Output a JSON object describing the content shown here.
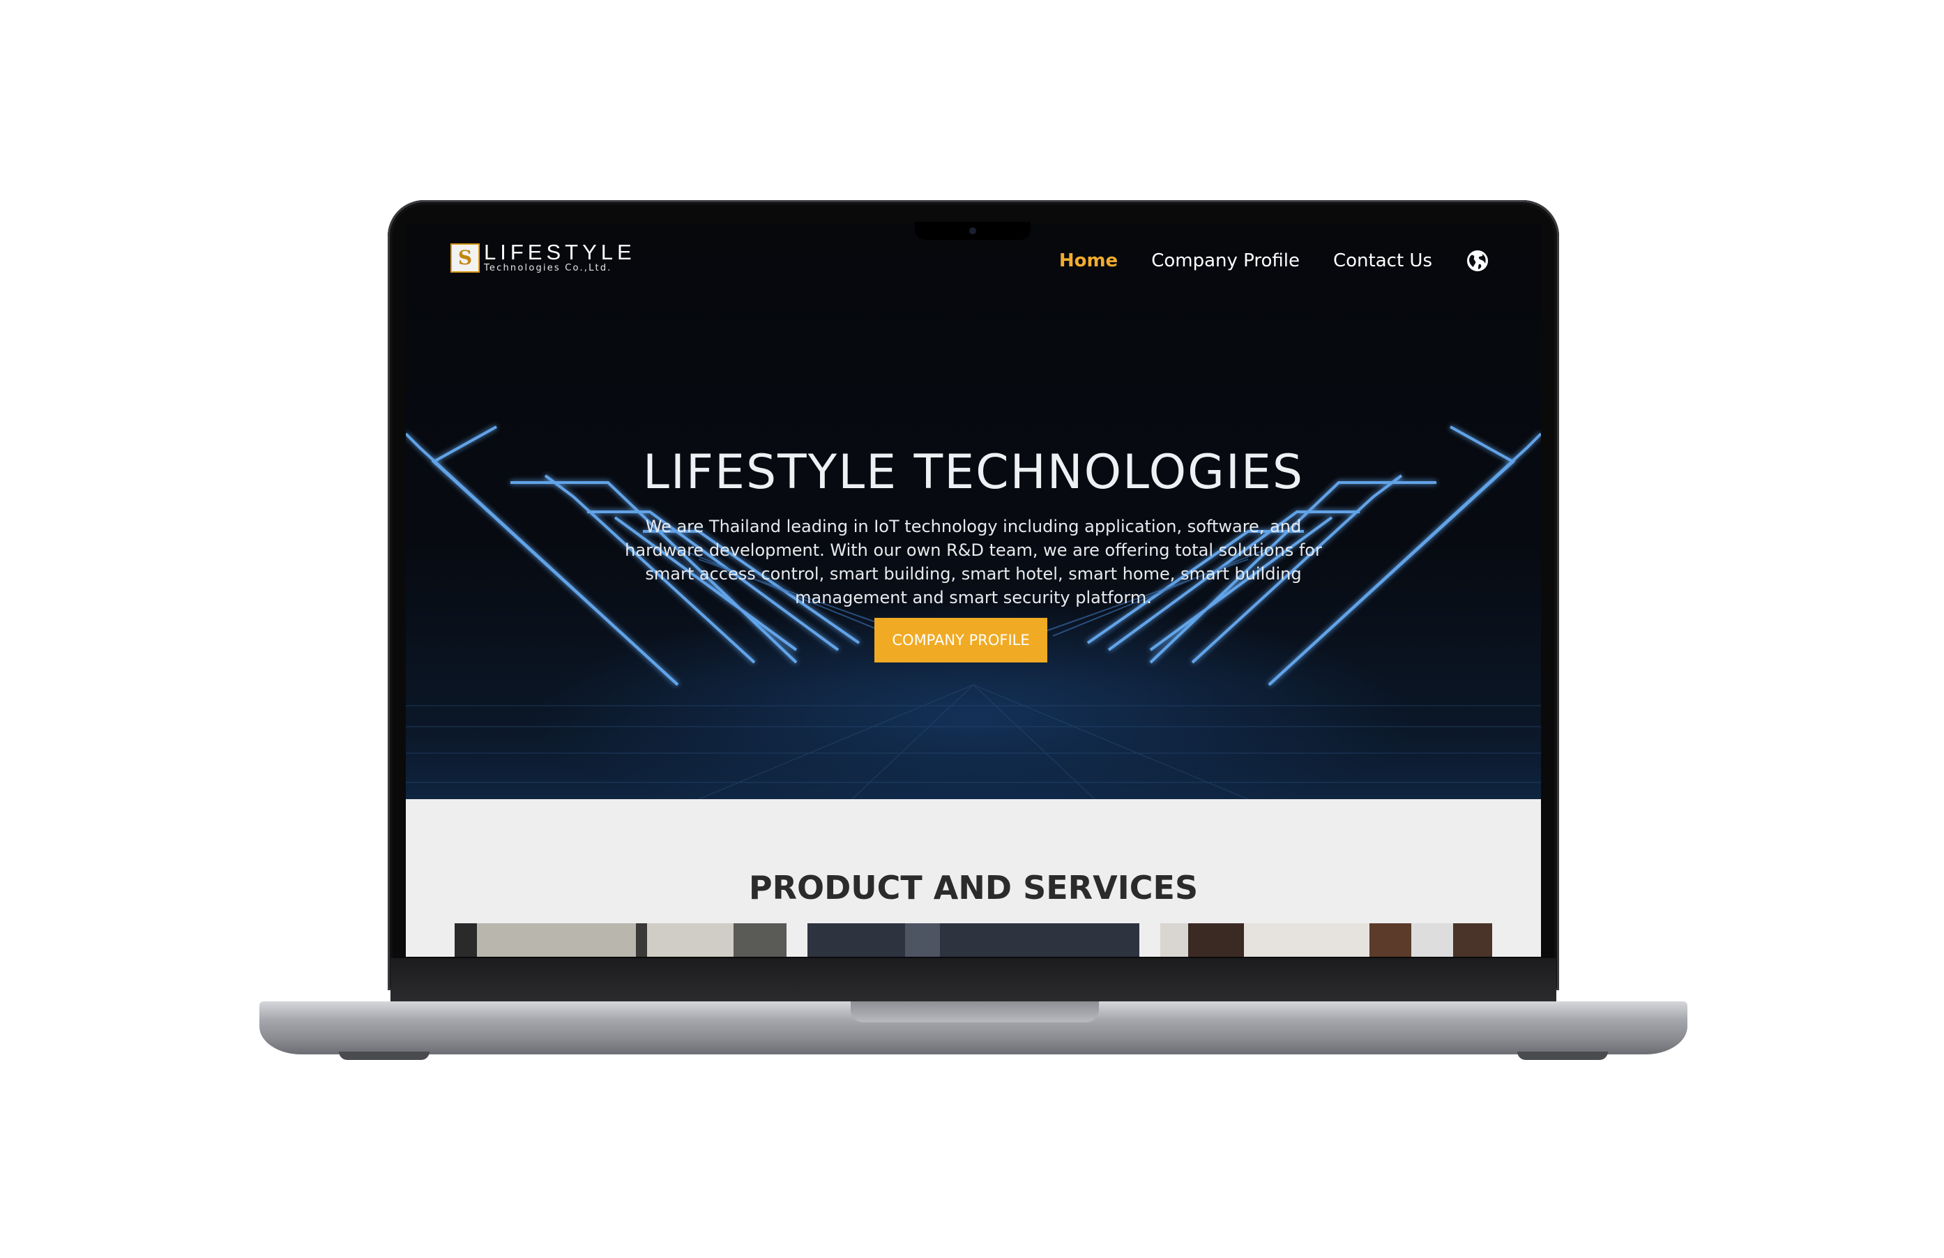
{
  "nav": {
    "logo_title": "LIFESTYLE",
    "logo_subtitle": "Technologies Co.,Ltd.",
    "logo_mark": "S",
    "links": [
      "Home",
      "Company Profile",
      "Contact Us"
    ],
    "active_link": "Home",
    "globe_icon": "globe-icon"
  },
  "hero": {
    "title": "LIFESTYLE TECHNOLOGIES",
    "description": "We are Thailand leading in IoT technology including application, software, and hardware development. With our own R&D team, we are offering total solutions for smart access control, smart building, smart hotel, smart home, smart building management and smart security platform.",
    "button_label": "COMPANY PROFILE"
  },
  "products": {
    "title": "PRODUCT AND SERVICES"
  },
  "colors": {
    "accent": "#f0aa24",
    "hero_background": "#07090d",
    "section_background": "#efeeef",
    "neon_line": "#5aa8ff"
  }
}
